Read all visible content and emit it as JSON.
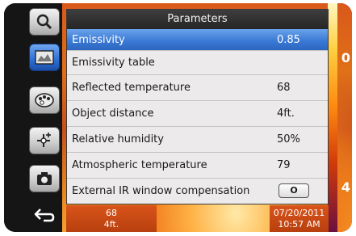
{
  "panel": {
    "title": "Parameters",
    "rows": [
      {
        "label": "Emissivity",
        "value": "0.85"
      },
      {
        "label": "Emissivity table",
        "value": ""
      },
      {
        "label": "Reflected temperature",
        "value": "68"
      },
      {
        "label": "Object distance",
        "value": "4ft."
      },
      {
        "label": "Relative humidity",
        "value": "50%"
      },
      {
        "label": "Atmospheric temperature",
        "value": "79"
      },
      {
        "label": "External IR window compensation",
        "value": "O"
      }
    ]
  },
  "sidebar": {
    "icons": [
      "magnifier-icon",
      "image-gallery-icon",
      "palette-icon",
      "measurement-spot-icon",
      "camera-icon",
      "back-arrow-icon"
    ]
  },
  "status": {
    "left_line1": "68",
    "left_line2": "4ft.",
    "date": "07/20/2011",
    "time": "10:57 AM"
  },
  "edge_labels": {
    "right_top": "0",
    "right_bottom": "4"
  },
  "colors": {
    "selected_row": "#3b7ad6",
    "accent_orange": "#d8541a"
  }
}
